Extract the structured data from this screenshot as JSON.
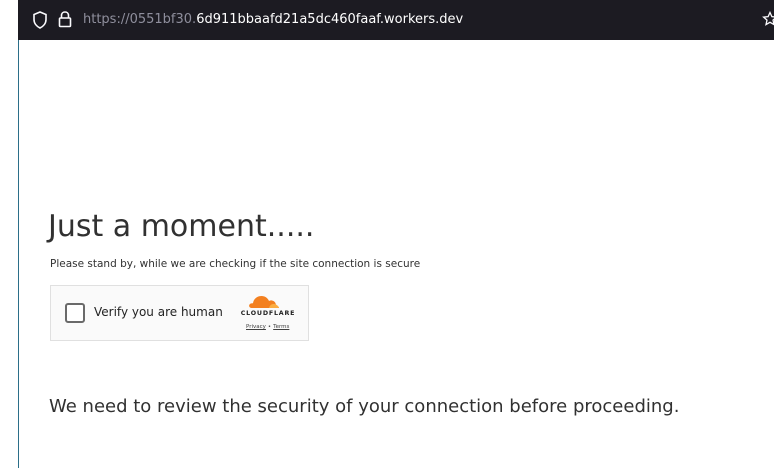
{
  "browser": {
    "url_scheme_part": "https://0551bf30.",
    "url_host_part": "6d911bbaafd21a5dc460faaf.workers.dev",
    "icons": [
      "shield-icon",
      "lock-icon",
      "bookmark-star-icon"
    ]
  },
  "page": {
    "title": "Just a moment.....",
    "subtitle": "Please stand by, while we are checking if the site connection is secure",
    "challenge": {
      "checkbox_label": "Verify you are human",
      "brand": "CLOUDFLARE",
      "privacy_link": "Privacy",
      "separator": "•",
      "terms_link": "Terms",
      "brand_color": "#f38020"
    },
    "message": "We need to review the security of your connection before proceeding."
  }
}
